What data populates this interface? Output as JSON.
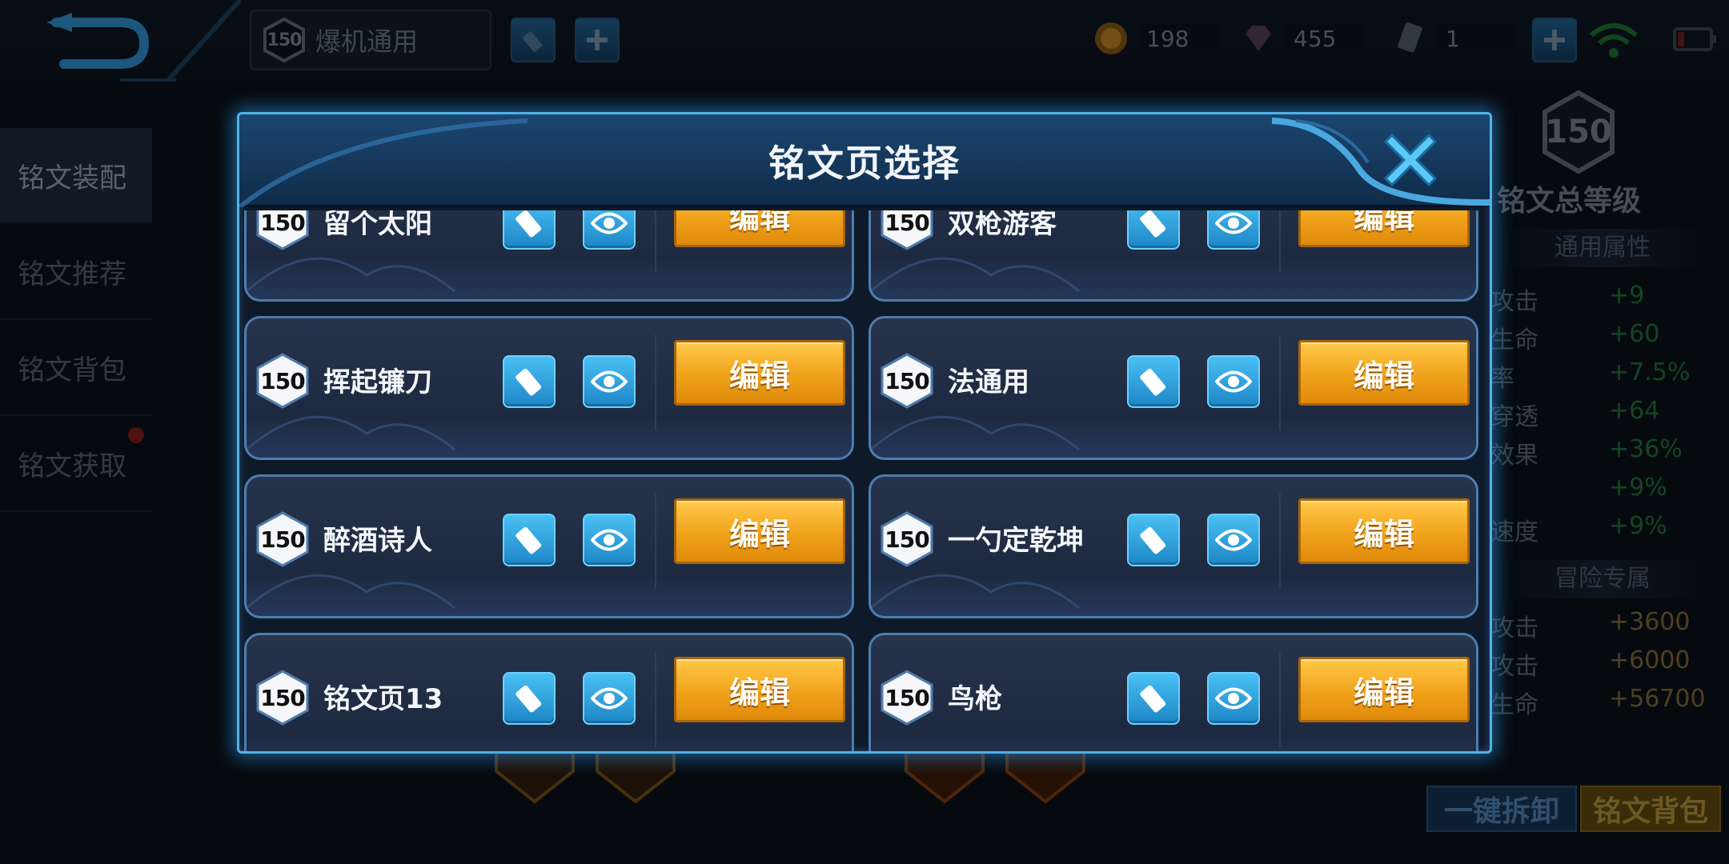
{
  "topbar": {
    "current_page": {
      "level": "150",
      "name": "爆机通用"
    },
    "currencies": [
      {
        "icon": "gold-coin-icon",
        "value": "198"
      },
      {
        "icon": "diamond-icon",
        "value": "455"
      },
      {
        "icon": "ticket-icon",
        "value": "1"
      }
    ]
  },
  "side_menu": {
    "items": [
      {
        "label": "铭文装配",
        "active": true
      },
      {
        "label": "铭文推荐",
        "active": false
      },
      {
        "label": "铭文背包",
        "active": false
      },
      {
        "label": "铭文获取",
        "active": false,
        "badge": true
      }
    ]
  },
  "right_panel": {
    "total_level": "150",
    "title": "铭文总等级",
    "general_header": "通用属性",
    "general_attrs": [
      {
        "name": "攻击",
        "value": "+9"
      },
      {
        "name": "生命",
        "value": "+60"
      },
      {
        "name": "率",
        "value": "+7.5%"
      },
      {
        "name": "穿透",
        "value": "+64"
      },
      {
        "name": "效果",
        "value": "+36%"
      },
      {
        "name": "",
        "value": "+9%"
      },
      {
        "name": "速度",
        "value": "+9%"
      }
    ],
    "adventure_header": "冒险专属",
    "adventure_attrs": [
      {
        "name": "攻击",
        "value": "+3600"
      },
      {
        "name": "攻击",
        "value": "+6000"
      },
      {
        "name": "生命",
        "value": "+56700"
      }
    ]
  },
  "bottom_buttons": {
    "unequip_all": "一键拆卸",
    "rune_bag": "铭文背包"
  },
  "dialog": {
    "title": "铭文页选择",
    "edit_label": "编辑",
    "pages": [
      {
        "level": "150",
        "name": "留个太阳"
      },
      {
        "level": "150",
        "name": "双枪游客"
      },
      {
        "level": "150",
        "name": "挥起镰刀"
      },
      {
        "level": "150",
        "name": "法通用"
      },
      {
        "level": "150",
        "name": "醉酒诗人"
      },
      {
        "level": "150",
        "name": "一勺定乾坤"
      },
      {
        "level": "150",
        "name": "铭文页13"
      },
      {
        "level": "150",
        "name": "鸟枪"
      }
    ]
  },
  "colors": {
    "dialog_border": "#4fb2e8",
    "edit_button": "#f0a21a",
    "icon_button": "#2a9ad8"
  }
}
